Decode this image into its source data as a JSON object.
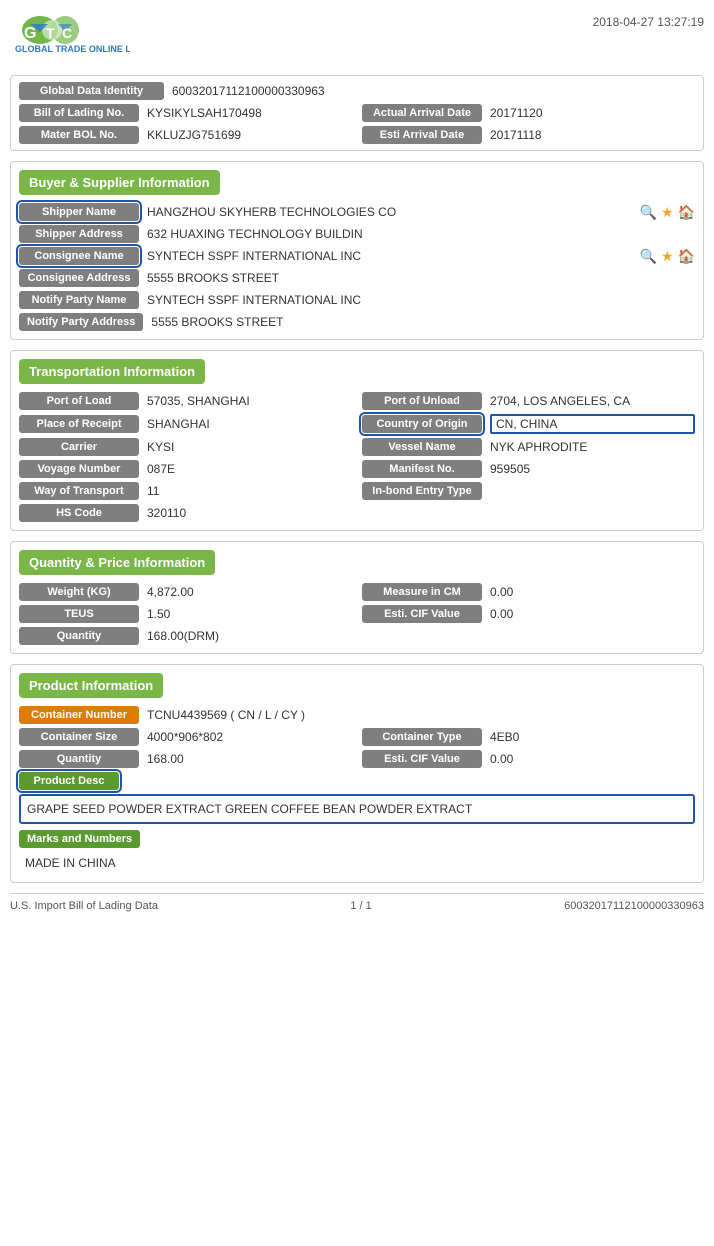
{
  "header": {
    "timestamp": "2018-04-27 13:27:19"
  },
  "top": {
    "global_data_identity_label": "Global Data Identity",
    "global_data_identity_value": "60032017112100000330963",
    "bill_of_lading_label": "Bill of Lading No.",
    "bill_of_lading_value": "KYSIKYLSAH170498",
    "actual_arrival_date_label": "Actual Arrival Date",
    "actual_arrival_date_value": "20171120",
    "mater_bol_label": "Mater BOL No.",
    "mater_bol_value": "KKLUZJG751699",
    "esti_arrival_date_label": "Esti Arrival Date",
    "esti_arrival_date_value": "20171118"
  },
  "buyer_supplier": {
    "section_title": "Buyer & Supplier Information",
    "shipper_name_label": "Shipper Name",
    "shipper_name_value": "HANGZHOU SKYHERB TECHNOLOGIES CO",
    "shipper_address_label": "Shipper Address",
    "shipper_address_value": "632 HUAXING TECHNOLOGY BUILDIN",
    "consignee_name_label": "Consignee Name",
    "consignee_name_value": "SYNTECH SSPF INTERNATIONAL INC",
    "consignee_address_label": "Consignee Address",
    "consignee_address_value": "5555 BROOKS STREET",
    "notify_party_name_label": "Notify Party Name",
    "notify_party_name_value": "SYNTECH SSPF INTERNATIONAL INC",
    "notify_party_address_label": "Notify Party Address",
    "notify_party_address_value": "5555 BROOKS STREET"
  },
  "transportation": {
    "section_title": "Transportation Information",
    "port_of_load_label": "Port of Load",
    "port_of_load_value": "57035, SHANGHAI",
    "port_of_unload_label": "Port of Unload",
    "port_of_unload_value": "2704, LOS ANGELES, CA",
    "place_of_receipt_label": "Place of Receipt",
    "place_of_receipt_value": "SHANGHAI",
    "country_of_origin_label": "Country of Origin",
    "country_of_origin_value": "CN, CHINA",
    "carrier_label": "Carrier",
    "carrier_value": "KYSI",
    "vessel_name_label": "Vessel Name",
    "vessel_name_value": "NYK APHRODITE",
    "voyage_number_label": "Voyage Number",
    "voyage_number_value": "087E",
    "manifest_no_label": "Manifest No.",
    "manifest_no_value": "959505",
    "way_of_transport_label": "Way of Transport",
    "way_of_transport_value": "11",
    "inbond_entry_type_label": "In-bond Entry Type",
    "inbond_entry_type_value": "",
    "hs_code_label": "HS Code",
    "hs_code_value": "320110"
  },
  "quantity_price": {
    "section_title": "Quantity & Price Information",
    "weight_label": "Weight (KG)",
    "weight_value": "4,872.00",
    "measure_in_cm_label": "Measure in CM",
    "measure_in_cm_value": "0.00",
    "teus_label": "TEUS",
    "teus_value": "1.50",
    "esti_cif_value_label": "Esti. CIF Value",
    "esti_cif_value_value": "0.00",
    "quantity_label": "Quantity",
    "quantity_value": "168.00(DRM)"
  },
  "product": {
    "section_title": "Product Information",
    "container_number_label": "Container Number",
    "container_number_value": "TCNU4439569 ( CN / L / CY )",
    "container_size_label": "Container Size",
    "container_size_value": "4000*906*802",
    "container_type_label": "Container Type",
    "container_type_value": "4EB0",
    "quantity_label": "Quantity",
    "quantity_value": "168.00",
    "esti_cif_value_label": "Esti. CIF Value",
    "esti_cif_value_value": "0.00",
    "product_desc_label": "Product Desc",
    "product_desc_value": "GRAPE SEED POWDER EXTRACT GREEN COFFEE BEAN POWDER EXTRACT",
    "marks_and_numbers_label": "Marks and Numbers",
    "marks_and_numbers_value": "MADE IN CHINA"
  },
  "footer": {
    "left": "U.S. Import Bill of Lading Data",
    "center": "1 / 1",
    "right": "60032017112100000330963"
  }
}
